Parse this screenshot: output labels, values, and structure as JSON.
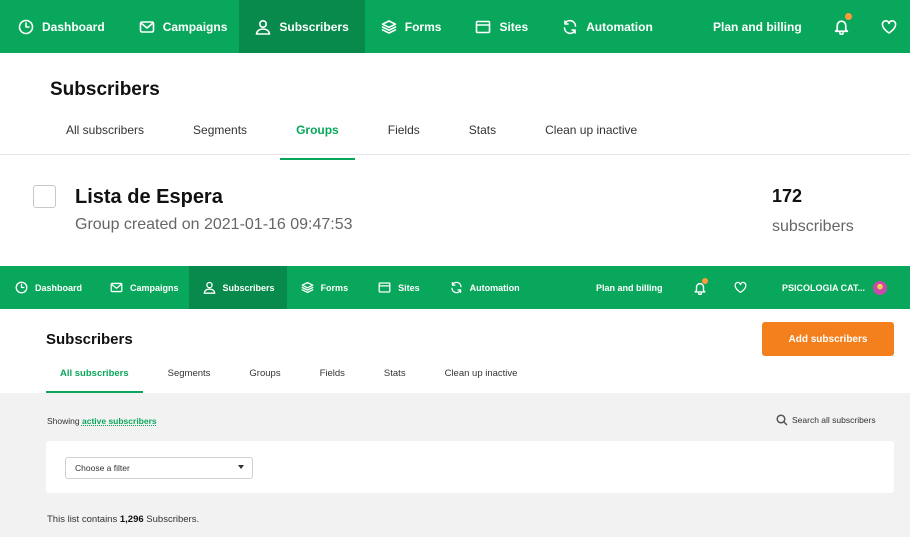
{
  "nav": {
    "items": [
      {
        "label": "Dashboard",
        "icon": "clock-icon"
      },
      {
        "label": "Campaigns",
        "icon": "envelope-icon"
      },
      {
        "label": "Subscribers",
        "icon": "user-icon",
        "active": true
      },
      {
        "label": "Forms",
        "icon": "layers-icon"
      },
      {
        "label": "Sites",
        "icon": "browser-icon"
      },
      {
        "label": "Automation",
        "icon": "refresh-icon"
      }
    ],
    "plan_billing": "Plan and billing",
    "account_name": "PSICOLOGIA CAT...",
    "accent": "#09a75b",
    "active_bg": "#088a4c",
    "notification_dot": "#ff9a3d"
  },
  "top": {
    "title": "Subscribers",
    "tabs": [
      "All subscribers",
      "Segments",
      "Groups",
      "Fields",
      "Stats",
      "Clean up inactive"
    ],
    "active_tab": "Groups",
    "group": {
      "name": "Lista de Espera",
      "created": "Group created on 2021-01-16 09:47:53",
      "count": "172",
      "count_label": "subscribers"
    }
  },
  "bottom": {
    "title": "Subscribers",
    "add_button": "Add subscribers",
    "tabs": [
      "All subscribers",
      "Segments",
      "Groups",
      "Fields",
      "Stats",
      "Clean up inactive"
    ],
    "active_tab": "All subscribers",
    "showing_prefix": "Showing",
    "showing_link": "active subscribers",
    "search_link": "Search all subscribers",
    "filter_placeholder": "Choose a filter",
    "list_prefix": "This list contains",
    "list_count": "1,296",
    "list_suffix": "Subscribers.",
    "button_color": "#f3801c"
  }
}
